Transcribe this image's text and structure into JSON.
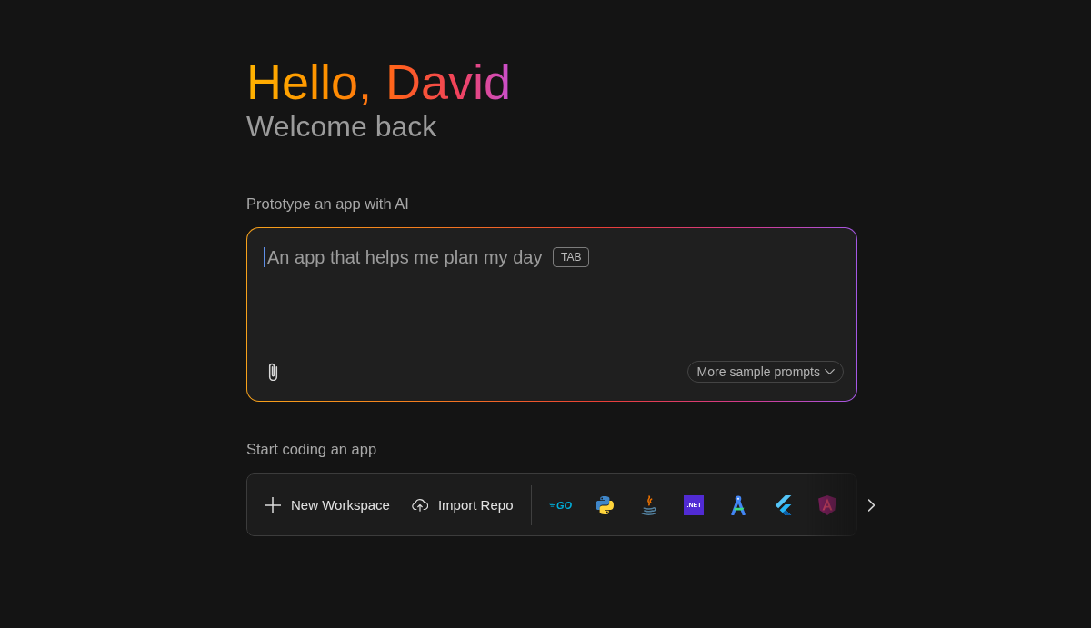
{
  "greeting": {
    "title": "Hello, David",
    "subtitle": "Welcome back"
  },
  "prototype": {
    "label": "Prototype an app with AI",
    "prompt": {
      "placeholder": "An app that helps me plan my day",
      "focused": true,
      "shortcut": "TAB"
    },
    "more_button": "More sample prompts"
  },
  "coding": {
    "label": "Start coding an app",
    "actions": [
      {
        "kind": "new",
        "label": "New Workspace"
      },
      {
        "kind": "import",
        "label": "Import Repo"
      }
    ],
    "templates": [
      {
        "kind": "go",
        "label": "GO"
      },
      {
        "kind": "python"
      },
      {
        "kind": "java"
      },
      {
        "kind": "dotnet",
        "label": ".NET"
      },
      {
        "kind": "android"
      },
      {
        "kind": "flutter"
      },
      {
        "kind": "angular"
      }
    ]
  }
}
